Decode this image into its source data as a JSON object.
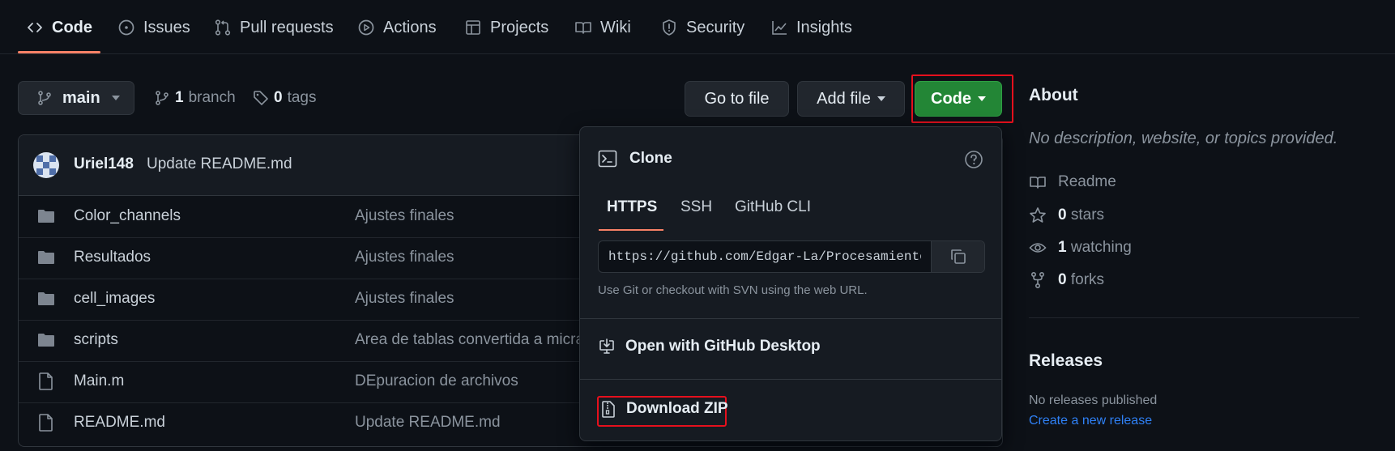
{
  "nav": {
    "tabs": [
      {
        "label": "Code",
        "icon": "code-icon"
      },
      {
        "label": "Issues",
        "icon": "issue-icon"
      },
      {
        "label": "Pull requests",
        "icon": "pull-request-icon"
      },
      {
        "label": "Actions",
        "icon": "play-icon"
      },
      {
        "label": "Projects",
        "icon": "table-icon"
      },
      {
        "label": "Wiki",
        "icon": "book-icon"
      },
      {
        "label": "Security",
        "icon": "shield-icon"
      },
      {
        "label": "Insights",
        "icon": "graph-icon"
      }
    ]
  },
  "toolbar": {
    "branch": "main",
    "branch_count": "1",
    "branch_label": "branch",
    "tag_count": "0",
    "tag_label": "tags",
    "go_to_file": "Go to file",
    "add_file": "Add file",
    "code_button": "Code"
  },
  "commit": {
    "author": "Uriel148",
    "message": "Update README.md"
  },
  "files": [
    {
      "type": "folder",
      "name": "Color_channels",
      "message": "Ajustes finales"
    },
    {
      "type": "folder",
      "name": "Resultados",
      "message": "Ajustes finales"
    },
    {
      "type": "folder",
      "name": "cell_images",
      "message": "Ajustes finales"
    },
    {
      "type": "folder",
      "name": "scripts",
      "message": "Area de tablas convertida a micras"
    },
    {
      "type": "file",
      "name": "Main.m",
      "message": "DEpuracion de archivos"
    },
    {
      "type": "file",
      "name": "README.md",
      "message": "Update README.md"
    }
  ],
  "clone": {
    "title": "Clone",
    "tabs": [
      "HTTPS",
      "SSH",
      "GitHub CLI"
    ],
    "url": "https://github.com/Edgar-La/Procesamiento_",
    "hint": "Use Git or checkout with SVN using the web URL.",
    "open_desktop": "Open with GitHub Desktop",
    "download_zip": "Download ZIP"
  },
  "about": {
    "title": "About",
    "description": "No description, website, or topics provided.",
    "readme": "Readme",
    "stars": "0",
    "stars_label": "stars",
    "watching": "1",
    "watching_label": "watching",
    "forks": "0",
    "forks_label": "forks"
  },
  "releases": {
    "title": "Releases",
    "none": "No releases published",
    "create": "Create a new release"
  },
  "colors": {
    "accent_green": "#238636",
    "link_blue": "#2f81f7",
    "highlight_red": "#e5101d",
    "tab_underline": "#f78166"
  }
}
